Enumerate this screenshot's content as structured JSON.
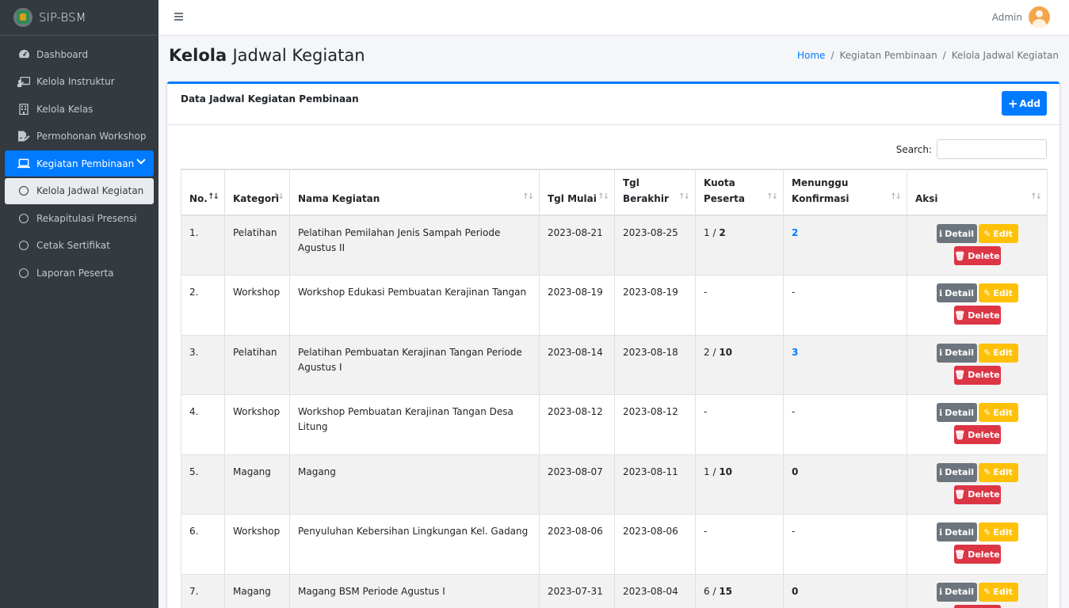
{
  "brand": {
    "name": "SIP-BSM"
  },
  "topbar": {
    "user_name": "Admin"
  },
  "sidebar": {
    "items": [
      {
        "label": "Dashboard",
        "icon": "tachometer-icon"
      },
      {
        "label": "Kelola Instruktur",
        "icon": "chalkboard-teacher-icon"
      },
      {
        "label": "Kelola Kelas",
        "icon": "building-icon"
      },
      {
        "label": "Permohonan Workshop",
        "icon": "file-signature-icon"
      },
      {
        "label": "Kegiatan Pembinaan",
        "icon": "laptop-icon"
      },
      {
        "label": "Kelola Jadwal Kegiatan",
        "icon": "circle-icon"
      },
      {
        "label": "Rekapitulasi Presensi",
        "icon": "circle-icon"
      },
      {
        "label": "Cetak Sertifikat",
        "icon": "circle-icon"
      },
      {
        "label": "Laporan Peserta",
        "icon": "circle-icon"
      }
    ]
  },
  "header": {
    "title_bold": "Kelola",
    "title_rest": "Jadwal Kegiatan",
    "breadcrumb": [
      "Home",
      "Kegiatan Pembinaan",
      "Kelola Jadwal Kegiatan"
    ]
  },
  "card": {
    "title": "Data Jadwal Kegiatan Pembinaan",
    "add_label": "Add",
    "search_label": "Search:"
  },
  "table": {
    "headers": [
      "No.",
      "Kategori",
      "Nama Kegiatan",
      "Tgl Mulai",
      "Tgl Berakhir",
      "Kuota Peserta",
      "Menunggu Konfirmasi",
      "Aksi"
    ],
    "actions": {
      "detail": "Detail",
      "edit": "Edit",
      "delete": "Delete"
    },
    "rows": [
      {
        "no": "1.",
        "kategori": "Pelatihan",
        "nama": "Pelatihan Pemilahan Jenis Sampah Periode Agustus II",
        "mulai": "2023-08-21",
        "berakhir": "2023-08-25",
        "kuota_filled": "1",
        "kuota_sep": " / ",
        "kuota_total": "2",
        "menunggu": "2"
      },
      {
        "no": "2.",
        "kategori": "Workshop",
        "nama": "Workshop Edukasi Pembuatan Kerajinan Tangan",
        "mulai": "2023-08-19",
        "berakhir": "2023-08-19",
        "kuota_filled": "-",
        "kuota_sep": "",
        "kuota_total": "",
        "menunggu": "-"
      },
      {
        "no": "3.",
        "kategori": "Pelatihan",
        "nama": "Pelatihan Pembuatan Kerajinan Tangan Periode Agustus I",
        "mulai": "2023-08-14",
        "berakhir": "2023-08-18",
        "kuota_filled": "2",
        "kuota_sep": " / ",
        "kuota_total": "10",
        "menunggu": "3"
      },
      {
        "no": "4.",
        "kategori": "Workshop",
        "nama": "Workshop Pembuatan Kerajinan Tangan Desa Litung",
        "mulai": "2023-08-12",
        "berakhir": "2023-08-12",
        "kuota_filled": "-",
        "kuota_sep": "",
        "kuota_total": "",
        "menunggu": "-"
      },
      {
        "no": "5.",
        "kategori": "Magang",
        "nama": "Magang",
        "mulai": "2023-08-07",
        "berakhir": "2023-08-11",
        "kuota_filled": "1",
        "kuota_sep": " / ",
        "kuota_total": "10",
        "menunggu": "0"
      },
      {
        "no": "6.",
        "kategori": "Workshop",
        "nama": "Penyuluhan Kebersihan Lingkungan Kel. Gadang",
        "mulai": "2023-08-06",
        "berakhir": "2023-08-06",
        "kuota_filled": "-",
        "kuota_sep": "",
        "kuota_total": "",
        "menunggu": "-"
      },
      {
        "no": "7.",
        "kategori": "Magang",
        "nama": "Magang BSM Periode Agustus I",
        "mulai": "2023-07-31",
        "berakhir": "2023-08-04",
        "kuota_filled": "6",
        "kuota_sep": " / ",
        "kuota_total": "15",
        "menunggu": "0"
      }
    ]
  }
}
